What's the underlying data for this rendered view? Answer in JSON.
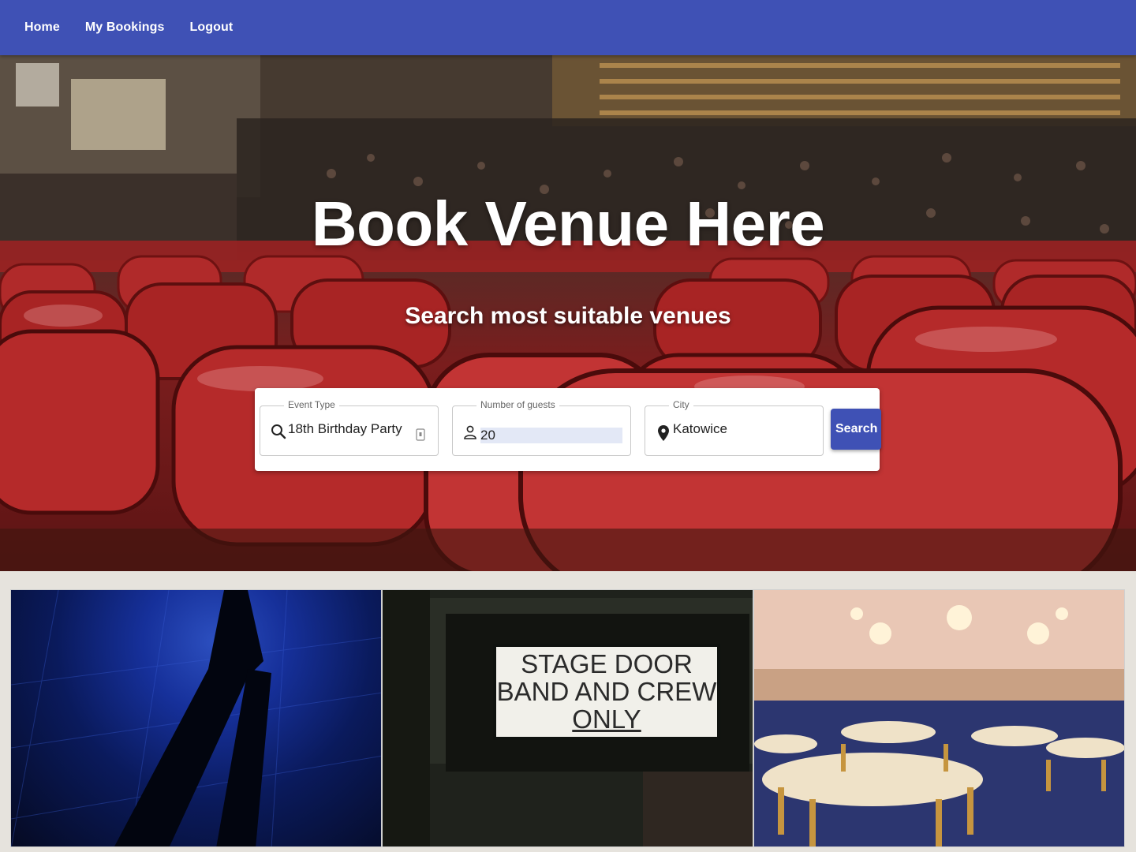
{
  "nav": {
    "items": [
      {
        "label": "Home"
      },
      {
        "label": "My Bookings"
      },
      {
        "label": "Logout"
      }
    ]
  },
  "hero": {
    "title": "Book Venue Here",
    "subtitle": "Search most suitable venues"
  },
  "search": {
    "event_type": {
      "label": "Event Type",
      "value": "18th Birthday Party",
      "icon": "search-icon"
    },
    "guests": {
      "label": "Number of guests",
      "value": "20",
      "icon": "person-icon"
    },
    "city": {
      "label": "City",
      "value": "Katowice",
      "icon": "location-pin-icon"
    },
    "button_label": "Search"
  },
  "gallery": {
    "tiles": [
      {
        "name": "shadow-on-blue-floor"
      },
      {
        "name": "stage-door-sign",
        "sign_lines": [
          "STAGE DOOR",
          "BAND AND CREW",
          "ONLY"
        ]
      },
      {
        "name": "banquet-hall"
      }
    ]
  },
  "colors": {
    "primary": "#3f51b5",
    "hero_red": "#8b1a1a"
  }
}
